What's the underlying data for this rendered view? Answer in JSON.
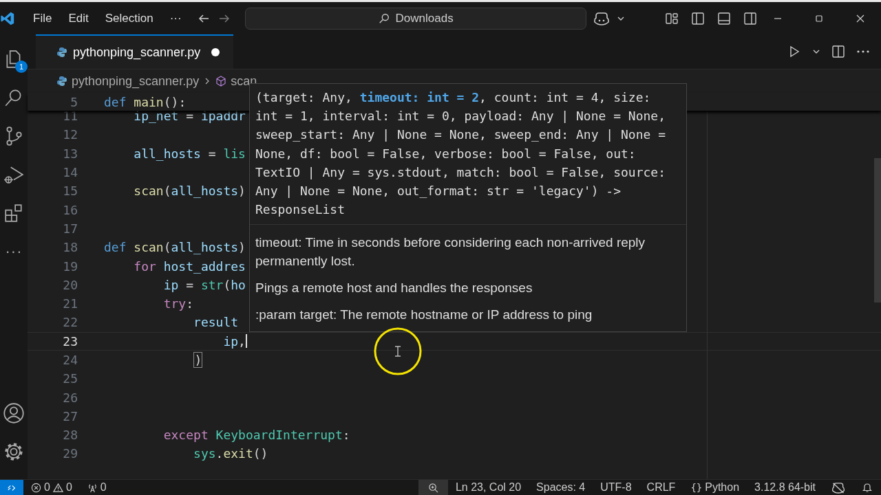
{
  "title_bar": {
    "menu": [
      "File",
      "Edit",
      "Selection",
      "···"
    ],
    "search": {
      "value": "Downloads"
    }
  },
  "activity_bar": {
    "items": [
      {
        "kind": "explorer",
        "badge": "1"
      },
      {
        "kind": "search"
      },
      {
        "kind": "source-control"
      },
      {
        "kind": "run"
      },
      {
        "kind": "extensions"
      },
      {
        "kind": "more",
        "text": "···"
      }
    ],
    "bottom": [
      {
        "kind": "account"
      },
      {
        "kind": "settings"
      }
    ]
  },
  "tabs": [
    {
      "label": "pythonping_scanner.py",
      "selected": true,
      "modified": true
    }
  ],
  "breadcrumb": [
    "pythonping_scanner.py",
    "scan"
  ],
  "editor": {
    "sticky": {
      "number": "5",
      "tokens": [
        {
          "text": "def",
          "kind": "keyword"
        },
        {
          "text": " main",
          "kind": "func"
        },
        {
          "text": "():",
          "kind": "plain"
        }
      ]
    },
    "lines": [
      {
        "number": "11",
        "active": false,
        "tokens": [
          {
            "text": "    ip_net",
            "kind": "var"
          },
          {
            "text": " = ",
            "kind": "plain"
          },
          {
            "text": "ipaddr",
            "kind": "var"
          }
        ]
      },
      {
        "number": "12",
        "active": false
      },
      {
        "number": "13",
        "active": false,
        "tokens": [
          {
            "text": "    all_hosts",
            "kind": "var"
          },
          {
            "text": " = ",
            "kind": "plain"
          },
          {
            "text": "lis",
            "kind": "class"
          }
        ]
      },
      {
        "number": "14",
        "active": false
      },
      {
        "number": "15",
        "active": false,
        "tokens": [
          {
            "text": "    scan",
            "kind": "func"
          },
          {
            "text": "(",
            "kind": "plain"
          },
          {
            "text": "all_hosts",
            "kind": "var"
          },
          {
            "text": ")",
            "kind": "plain"
          }
        ]
      },
      {
        "number": "16",
        "active": false
      },
      {
        "number": "17",
        "active": false
      },
      {
        "number": "18",
        "active": false,
        "tokens": [
          {
            "text": "def",
            "kind": "keyword"
          },
          {
            "text": " scan",
            "kind": "func"
          },
          {
            "text": "(",
            "kind": "plain"
          },
          {
            "text": "all_hosts",
            "kind": "var"
          },
          {
            "text": ")",
            "kind": "plain"
          }
        ]
      },
      {
        "number": "19",
        "active": false,
        "tokens": [
          {
            "text": "    for",
            "kind": "control"
          },
          {
            "text": " host_addres",
            "kind": "var"
          }
        ]
      },
      {
        "number": "20",
        "active": false,
        "tokens": [
          {
            "text": "        ip",
            "kind": "var"
          },
          {
            "text": " = ",
            "kind": "plain"
          },
          {
            "text": "str",
            "kind": "class"
          },
          {
            "text": "(",
            "kind": "plain"
          },
          {
            "text": "ho",
            "kind": "var"
          }
        ]
      },
      {
        "number": "21",
        "active": false,
        "tokens": [
          {
            "text": "        try",
            "kind": "control"
          },
          {
            "text": ":",
            "kind": "plain"
          }
        ]
      },
      {
        "number": "22",
        "active": false,
        "tokens": [
          {
            "text": "            result",
            "kind": "var"
          }
        ]
      },
      {
        "number": "23",
        "active": true,
        "tokens": [
          {
            "text": "                ip",
            "kind": "var"
          },
          {
            "text": ",",
            "kind": "plain"
          }
        ]
      },
      {
        "number": "24",
        "active": false,
        "tokens": [
          {
            "text": ")",
            "kind": "bracket"
          }
        ]
      },
      {
        "number": "25",
        "active": false
      },
      {
        "number": "26",
        "active": false
      },
      {
        "number": "27",
        "active": false
      },
      {
        "number": "28",
        "active": false,
        "tokens": [
          {
            "text": "        except",
            "kind": "control"
          },
          {
            "text": " KeyboardInterrupt",
            "kind": "class"
          },
          {
            "text": ":",
            "kind": "plain"
          }
        ]
      },
      {
        "number": "29",
        "active": false,
        "tokens": [
          {
            "text": "            sys",
            "kind": "class"
          },
          {
            "text": ".",
            "kind": "plain"
          },
          {
            "text": "exit",
            "kind": "func"
          },
          {
            "text": "()",
            "kind": "plain"
          }
        ]
      }
    ]
  },
  "hover": {
    "signature": [
      [
        {
          "text": "(target: Any, ",
          "active": false
        },
        {
          "text": "timeout: int = 2",
          "active": true
        },
        {
          "text": ", count: int = 4, size:",
          "active": false
        }
      ],
      [
        {
          "text": "int = 1, interval: int = 0, payload: Any | None = None,",
          "active": false
        }
      ],
      [
        {
          "text": "sweep_start: Any | None = None, sweep_end: Any | None =",
          "active": false
        }
      ],
      [
        {
          "text": "None, df: bool = False, verbose: bool = False, out:",
          "active": false
        }
      ],
      [
        {
          "text": "TextIO | Any = sys.stdout, match: bool = False, source:",
          "active": false
        }
      ],
      [
        {
          "text": "Any | None = None, out_format: str = 'legacy') ->",
          "active": false
        }
      ],
      [
        {
          "text": "ResponseList",
          "active": false
        }
      ]
    ],
    "docs": [
      "timeout: Time in seconds before considering each non-arrived reply permanently lost.",
      "Pings a remote host and handles the responses",
      ":param target: The remote hostname or IP address to ping"
    ]
  },
  "status_bar": {
    "errors": "0",
    "warnings": "0",
    "ports": "0",
    "right": [
      "Ln 23, Col 20",
      "Spaces: 4",
      "UTF-8",
      "CRLF"
    ],
    "language": {
      "braces": "{}",
      "name": "Python"
    },
    "interpreter": "3.12.8 64-bit"
  }
}
